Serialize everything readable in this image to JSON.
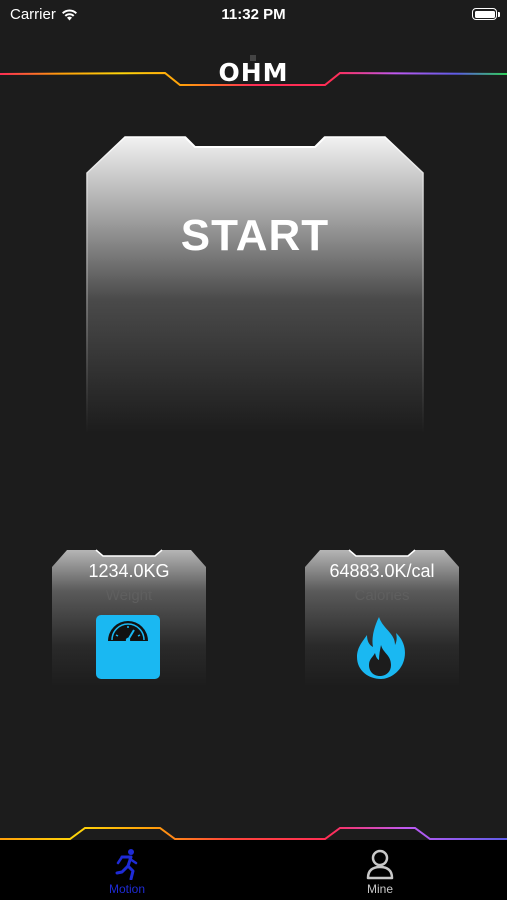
{
  "status_bar": {
    "carrier": "Carrier",
    "time": "11:32 PM"
  },
  "header": {
    "logo": "OHM"
  },
  "start": {
    "label": "START"
  },
  "stats": [
    {
      "value": "1234.0KG",
      "label": "Weight",
      "icon": "scale-icon"
    },
    {
      "value": "64883.0K/cal",
      "label": "Calories",
      "icon": "flame-icon"
    }
  ],
  "tab_bar": {
    "tabs": [
      {
        "label": "Motion",
        "icon": "running-person-icon",
        "active": true
      },
      {
        "label": "Mine",
        "icon": "user-profile-icon",
        "active": false
      }
    ]
  },
  "colors": {
    "background": "#1c1c1c",
    "accent_blue": "#1ab8f2",
    "active_tab": "#1e2bd6",
    "tab_bar": "#000000"
  }
}
